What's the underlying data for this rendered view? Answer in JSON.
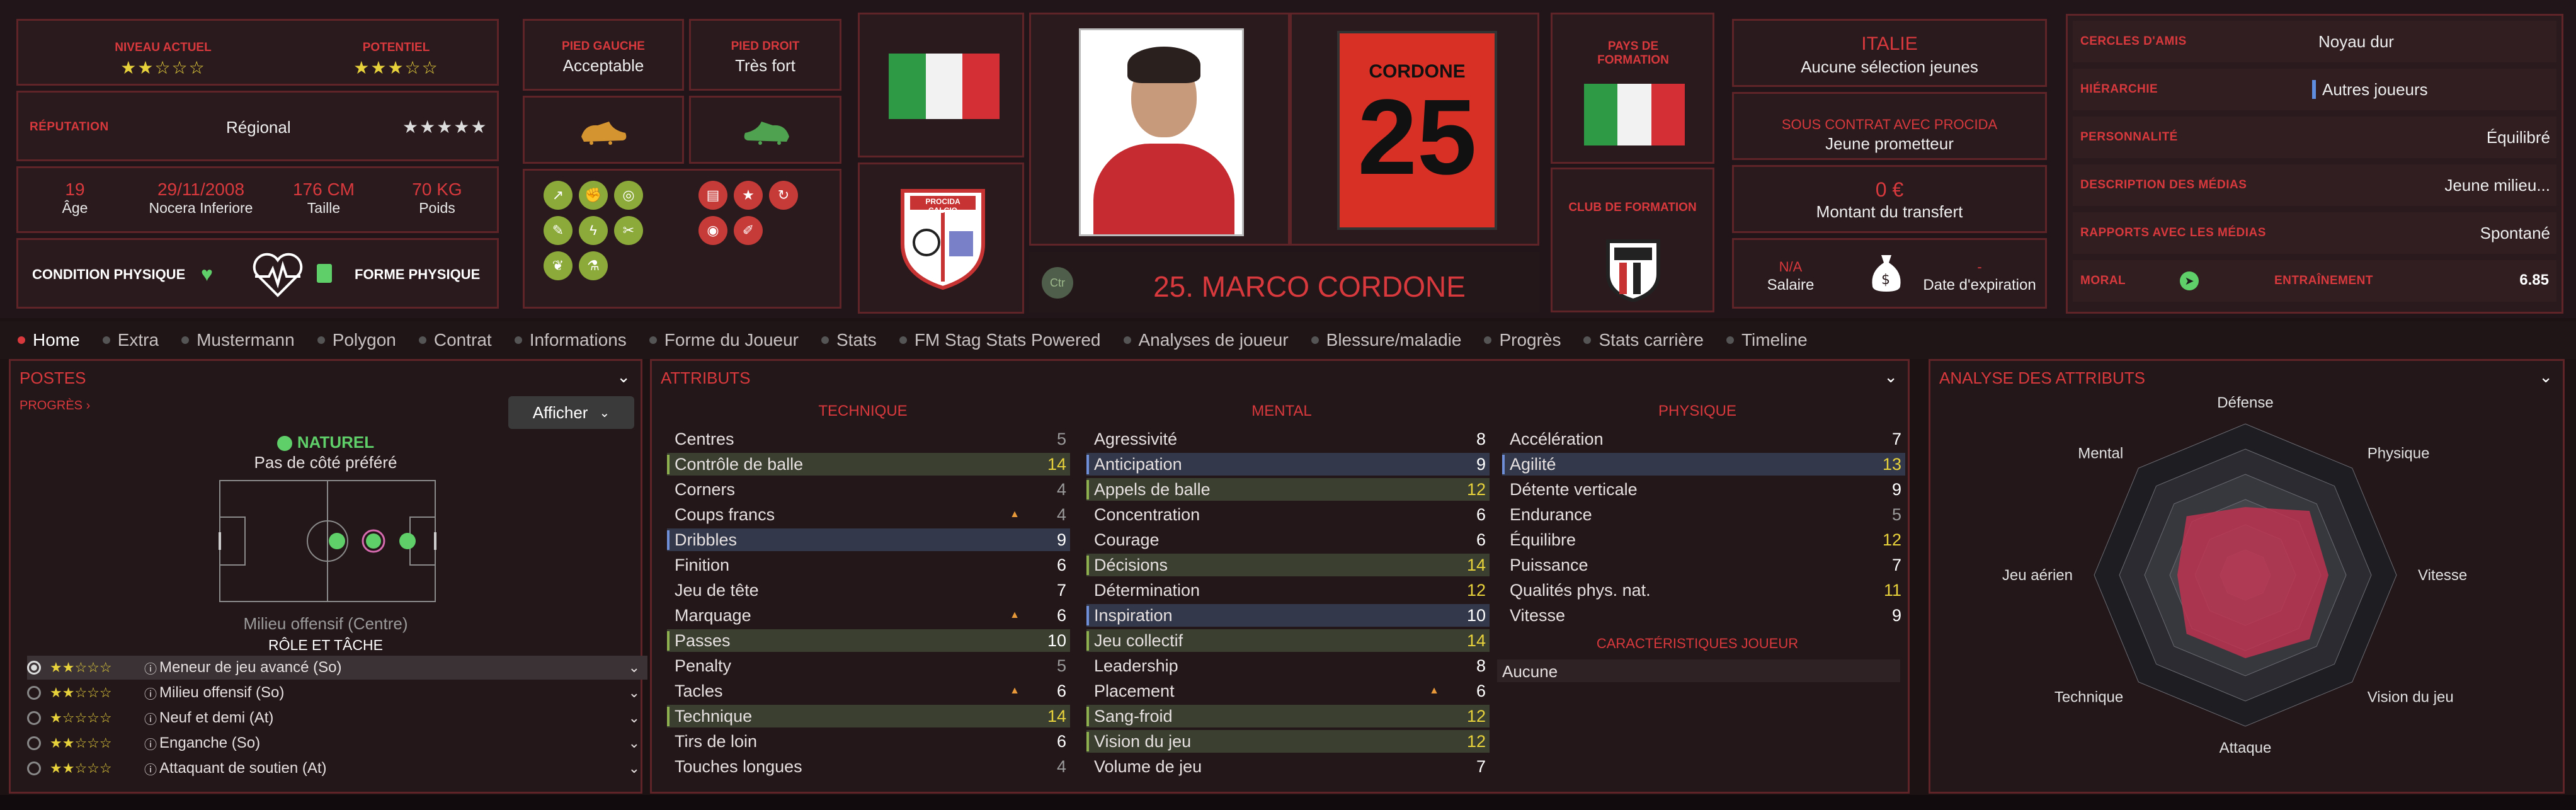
{
  "header": {
    "current_level_label": "NIVEAU ACTUEL",
    "current_level_stars": "★★☆☆☆",
    "potential_label": "POTENTIEL",
    "potential_stars": "★★★☆☆",
    "reputation_label": "RÉPUTATION",
    "reputation_value": "Régional",
    "reputation_stars": "★★★★★",
    "age_value": "19",
    "age_label": "Âge",
    "birth_value": "29/11/2008",
    "birth_place": "Nocera Inferiore",
    "height_value": "176 CM",
    "height_label": "Taille",
    "weight_value": "70 KG",
    "weight_label": "Poids",
    "condition_label": "CONDITION PHYSIQUE",
    "form_label": "FORME PHYSIQUE",
    "left_foot_label": "PIED GAUCHE",
    "left_foot_value": "Acceptable",
    "right_foot_label": "PIED DROIT",
    "right_foot_value": "Très fort",
    "club_badge_text": "PROCIDA CALCIO",
    "role_badge": "Ctr",
    "player_name": "25. MARCO CORDONE",
    "shirt_name": "CORDONE",
    "shirt_number": "25",
    "training_country_label": "PAYS DE FORMATION",
    "training_club_label": "CLUB DE FORMATION",
    "nation_title": "ITALIE",
    "nation_sub": "Aucune sélection jeunes",
    "contract_title": "SOUS CONTRAT AVEC PROCIDA",
    "contract_sub": "Jeune prometteur",
    "transfer_value": "0 €",
    "transfer_label": "Montant du transfert",
    "salary_value": "N/A",
    "salary_label": "Salaire",
    "expiry_value": "-",
    "expiry_label": "Date d'expiration",
    "friends_label": "CERCLES D'AMIS",
    "friends_value": "Noyau dur",
    "hierarchy_label": "HIÉRARCHIE",
    "hierarchy_value": "Autres joueurs",
    "personality_label": "PERSONNALITÉ",
    "personality_value": "Équilibré",
    "media_desc_label": "DESCRIPTION DES MÉDIAS",
    "media_desc_value": "Jeune milieu...",
    "media_rel_label": "RAPPORTS AVEC LES MÉDIAS",
    "media_rel_value": "Spontané",
    "morale_label": "MORAL",
    "training_label": "ENTRAÎNEMENT",
    "training_value": "6.85"
  },
  "tabs": [
    "Home",
    "Extra",
    "Mustermann",
    "Polygon",
    "Contrat",
    "Informations",
    "Forme du Joueur",
    "Stats",
    "FM Stag Stats Powered",
    "Analyses de joueur",
    "Blessure/maladie",
    "Progrès",
    "Stats carrière",
    "Timeline"
  ],
  "positions": {
    "title": "POSTES",
    "progress_link": "PROGRÈS",
    "show_button": "Afficher",
    "natural_label": "NATUREL",
    "foot_pref": "Pas de côté préféré",
    "position_caption": "Milieu offensif (Centre)",
    "role_title": "RÔLE ET TÂCHE",
    "roles": [
      {
        "stars": "★★☆☆☆",
        "name": "Meneur de jeu avancé (So)"
      },
      {
        "stars": "★★☆☆☆",
        "name": "Milieu offensif (So)"
      },
      {
        "stars": "★☆☆☆☆",
        "name": "Neuf et demi (At)"
      },
      {
        "stars": "★★☆☆☆",
        "name": "Enganche (So)"
      },
      {
        "stars": "★★☆☆☆",
        "name": "Attaquant de soutien (At)"
      }
    ]
  },
  "attributes": {
    "title": "ATTRIBUTS",
    "technique_title": "TECHNIQUE",
    "mental_title": "MENTAL",
    "physique_title": "PHYSIQUE",
    "traits_title": "CARACTÉRISTIQUES JOUEUR",
    "traits_value": "Aucune",
    "technique": [
      {
        "n": "Centres",
        "v": "5"
      },
      {
        "n": "Contrôle de balle",
        "v": "14"
      },
      {
        "n": "Corners",
        "v": "4"
      },
      {
        "n": "Coups francs",
        "v": "4"
      },
      {
        "n": "Dribbles",
        "v": "9"
      },
      {
        "n": "Finition",
        "v": "6"
      },
      {
        "n": "Jeu de tête",
        "v": "7"
      },
      {
        "n": "Marquage",
        "v": "6"
      },
      {
        "n": "Passes",
        "v": "10"
      },
      {
        "n": "Penalty",
        "v": "5"
      },
      {
        "n": "Tacles",
        "v": "6"
      },
      {
        "n": "Technique",
        "v": "14"
      },
      {
        "n": "Tirs de loin",
        "v": "6"
      },
      {
        "n": "Touches longues",
        "v": "4"
      }
    ],
    "mental": [
      {
        "n": "Agressivité",
        "v": "8"
      },
      {
        "n": "Anticipation",
        "v": "9"
      },
      {
        "n": "Appels de balle",
        "v": "12"
      },
      {
        "n": "Concentration",
        "v": "6"
      },
      {
        "n": "Courage",
        "v": "6"
      },
      {
        "n": "Décisions",
        "v": "14"
      },
      {
        "n": "Détermination",
        "v": "12"
      },
      {
        "n": "Inspiration",
        "v": "10"
      },
      {
        "n": "Jeu collectif",
        "v": "14"
      },
      {
        "n": "Leadership",
        "v": "8"
      },
      {
        "n": "Placement",
        "v": "6"
      },
      {
        "n": "Sang-froid",
        "v": "12"
      },
      {
        "n": "Vision du jeu",
        "v": "12"
      },
      {
        "n": "Volume de jeu",
        "v": "7"
      }
    ],
    "physique": [
      {
        "n": "Accélération",
        "v": "7"
      },
      {
        "n": "Agilité",
        "v": "13"
      },
      {
        "n": "Détente verticale",
        "v": "9"
      },
      {
        "n": "Endurance",
        "v": "5"
      },
      {
        "n": "Équilibre",
        "v": "12"
      },
      {
        "n": "Puissance",
        "v": "7"
      },
      {
        "n": "Qualités phys. nat.",
        "v": "11"
      },
      {
        "n": "Vitesse",
        "v": "9"
      }
    ]
  },
  "analysis": {
    "title": "ANALYSE DES ATTRIBUTS",
    "axes": [
      "Défense",
      "Physique",
      "Vitesse",
      "Vision du jeu",
      "Attaque",
      "Technique",
      "Jeu aérien",
      "Mental"
    ]
  },
  "colors": {
    "accent": "#d8393d",
    "panel": "#2a1a1d",
    "border": "#5e2428",
    "green": "#8caa3a",
    "yellow": "#e8d23c"
  }
}
